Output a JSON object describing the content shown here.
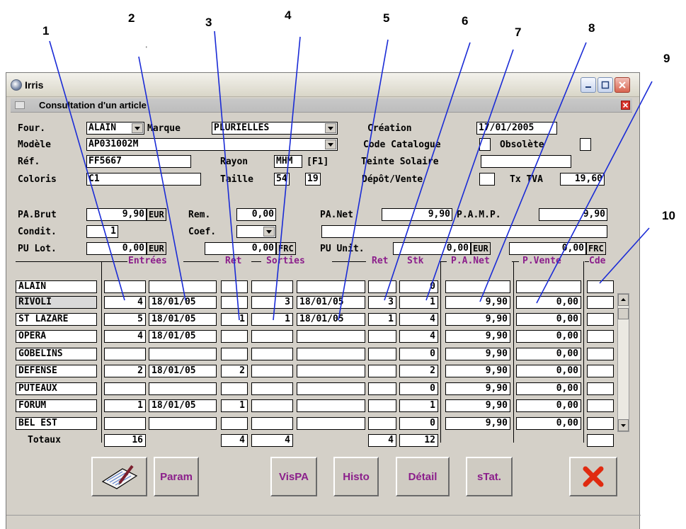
{
  "callouts": [
    "1",
    "2",
    "3",
    "4",
    "5",
    "6",
    "7",
    "8",
    "9",
    "10"
  ],
  "tick_mark": "'",
  "window": {
    "title": "Irris"
  },
  "subwindow": {
    "title": "Consultation d'un article"
  },
  "form": {
    "four_label": "Four.",
    "four_value": "ALAIN",
    "marque_label": "Marque",
    "marque_value": "PLURIELLES",
    "creation_label": "Création",
    "creation_value": "17/01/2005",
    "modele_label": "Modèle",
    "modele_value": "AP031002M",
    "code_catalogue_label": "Code Catalogue",
    "obsolete_label": "Obsolète",
    "ref_label": "Réf.",
    "ref_value": "FF5667",
    "rayon_label": "Rayon",
    "rayon_value": "MHM",
    "rayon_key": "[F1]",
    "teinte_label": "Teinte Solaire",
    "coloris_label": "Coloris",
    "coloris_value": "C1",
    "taille_label": "Taille",
    "taille_value1": "54",
    "taille_value2": "19",
    "depot_label": "Dépôt/Vente",
    "tva_label": "Tx TVA",
    "tva_value": "19,60",
    "pa_brut_label": "PA.Brut",
    "pa_brut_value": "9,90",
    "pa_brut_unit": "EUR",
    "rem_label": "Rem.",
    "rem_value": "0,00",
    "pa_net_label": "PA.Net",
    "pa_net_value": "9,90",
    "pamp_label": "P.A.M.P.",
    "pamp_value": "9,90",
    "condit_label": "Condit.",
    "condit_value": "1",
    "coef_label": "Coef.",
    "pv_lot_label": "PU Lot.",
    "pv_lot_value": "0,00",
    "pv_lot_unit": "EUR",
    "pv_lot_frc_value": "0,00",
    "pv_lot_frc_unit": "FRC",
    "pv_unit_label": "PU Unit.",
    "pv_unit_value": "0,00",
    "pv_unit_unit": "EUR",
    "pv_unit_frc_value": "0,00",
    "pv_unit_frc_unit": "FRC"
  },
  "grid": {
    "headers": {
      "entrees": "Entrées",
      "ret1": "Ret",
      "sorties": "Sorties",
      "ret2": "Ret",
      "stk": "Stk",
      "pa_net": "P.A.Net",
      "p_vente": "P.Vente",
      "cde": "Cde"
    },
    "rows": [
      {
        "store": "ALAIN",
        "ent_qty": "",
        "ent_date": "",
        "ret1": "",
        "sort_qty": "",
        "sort_date": "",
        "ret2": "",
        "stk": "0",
        "pa_net": "",
        "p_vente": ""
      },
      {
        "store": "RIVOLI",
        "ent_qty": "4",
        "ent_date": "18/01/05",
        "ret1": "",
        "sort_qty": "3",
        "sort_date": "18/01/05",
        "ret2": "3",
        "stk": "1",
        "pa_net": "9,90",
        "p_vente": "0,00"
      },
      {
        "store": "ST LAZARE",
        "ent_qty": "5",
        "ent_date": "18/01/05",
        "ret1": "1",
        "sort_qty": "1",
        "sort_date": "18/01/05",
        "ret2": "1",
        "stk": "4",
        "pa_net": "9,90",
        "p_vente": "0,00"
      },
      {
        "store": "OPERA",
        "ent_qty": "4",
        "ent_date": "18/01/05",
        "ret1": "",
        "sort_qty": "",
        "sort_date": "",
        "ret2": "",
        "stk": "4",
        "pa_net": "9,90",
        "p_vente": "0,00"
      },
      {
        "store": "GOBELINS",
        "ent_qty": "",
        "ent_date": "",
        "ret1": "",
        "sort_qty": "",
        "sort_date": "",
        "ret2": "",
        "stk": "0",
        "pa_net": "9,90",
        "p_vente": "0,00"
      },
      {
        "store": "DEFENSE",
        "ent_qty": "2",
        "ent_date": "18/01/05",
        "ret1": "2",
        "sort_qty": "",
        "sort_date": "",
        "ret2": "",
        "stk": "2",
        "pa_net": "9,90",
        "p_vente": "0,00"
      },
      {
        "store": "PUTEAUX",
        "ent_qty": "",
        "ent_date": "",
        "ret1": "",
        "sort_qty": "",
        "sort_date": "",
        "ret2": "",
        "stk": "0",
        "pa_net": "9,90",
        "p_vente": "0,00"
      },
      {
        "store": "FORUM",
        "ent_qty": "1",
        "ent_date": "18/01/05",
        "ret1": "1",
        "sort_qty": "",
        "sort_date": "",
        "ret2": "",
        "stk": "1",
        "pa_net": "9,90",
        "p_vente": "0,00"
      },
      {
        "store": "BEL EST",
        "ent_qty": "",
        "ent_date": "",
        "ret1": "",
        "sort_qty": "",
        "sort_date": "",
        "ret2": "",
        "stk": "0",
        "pa_net": "9,90",
        "p_vente": "0,00"
      }
    ],
    "totals_label": "Totaux",
    "totals": {
      "ent_qty": "16",
      "ret1": "4",
      "sort_qty": "4",
      "ret2": "4",
      "stk": "12"
    }
  },
  "buttons": {
    "param": "Param",
    "vispa": "VisPA",
    "histo": "Histo",
    "detail": "Détail",
    "stat": "sTat."
  },
  "colors": {
    "header_text": "#8b1e8b",
    "annotation_line": "#1a2bd6"
  }
}
